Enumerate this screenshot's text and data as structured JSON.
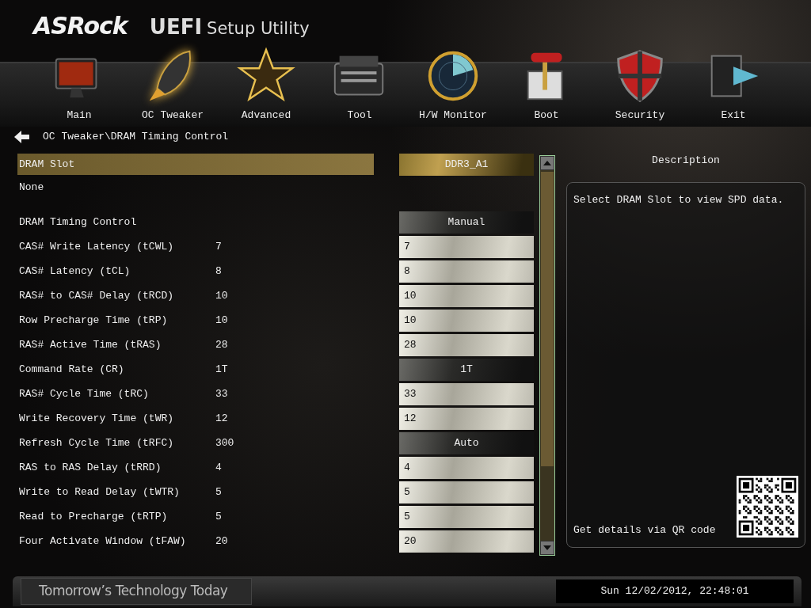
{
  "header": {
    "brand": "ASRock",
    "product": "UEFI",
    "subtitle": "Setup Utility"
  },
  "tabs": [
    {
      "label": "Main",
      "kind": "monitor",
      "selected": false
    },
    {
      "label": "OC Tweaker",
      "kind": "rocket",
      "selected": true
    },
    {
      "label": "Advanced",
      "kind": "star",
      "selected": false
    },
    {
      "label": "Tool",
      "kind": "toolbox",
      "selected": false
    },
    {
      "label": "H/W Monitor",
      "kind": "radar",
      "selected": false
    },
    {
      "label": "Boot",
      "kind": "lever",
      "selected": false
    },
    {
      "label": "Security",
      "kind": "shield",
      "selected": false
    },
    {
      "label": "Exit",
      "kind": "exit",
      "selected": false
    }
  ],
  "breadcrumb": "OC Tweaker\\DRAM Timing Control",
  "settings": [
    {
      "label": "DRAM Slot",
      "kind": "select",
      "control": "DDR3_A1",
      "selected": true
    },
    {
      "label": "None",
      "kind": "info",
      "selected": false
    },
    {
      "label": "DRAM Timing Control",
      "kind": "select",
      "control": "Manual",
      "selected": false
    },
    {
      "label": "CAS# Write Latency (tCWL)",
      "value": "7",
      "kind": "input",
      "control": "7",
      "selected": false
    },
    {
      "label": "CAS# Latency (tCL)",
      "value": "8",
      "kind": "input",
      "control": "8",
      "selected": false
    },
    {
      "label": "RAS# to CAS# Delay (tRCD)",
      "value": "10",
      "kind": "input",
      "control": "10",
      "selected": false
    },
    {
      "label": "Row Precharge Time (tRP)",
      "value": "10",
      "kind": "input",
      "control": "10",
      "selected": false
    },
    {
      "label": "RAS# Active Time (tRAS)",
      "value": "28",
      "kind": "input",
      "control": "28",
      "selected": false
    },
    {
      "label": "Command Rate (CR)",
      "value": "1T",
      "kind": "select",
      "control": "1T",
      "selected": false
    },
    {
      "label": "RAS# Cycle Time (tRC)",
      "value": "33",
      "kind": "input",
      "control": "33",
      "selected": false
    },
    {
      "label": "Write Recovery Time (tWR)",
      "value": "12",
      "kind": "input",
      "control": "12",
      "selected": false
    },
    {
      "label": "Refresh Cycle Time (tRFC)",
      "value": "300",
      "kind": "select",
      "control": "Auto",
      "selected": false
    },
    {
      "label": "RAS to RAS Delay (tRRD)",
      "value": "4",
      "kind": "input",
      "control": "4",
      "selected": false
    },
    {
      "label": "Write to Read Delay (tWTR)",
      "value": "5",
      "kind": "input",
      "control": "5",
      "selected": false
    },
    {
      "label": "Read to Precharge (tRTP)",
      "value": "5",
      "kind": "input",
      "control": "5",
      "selected": false
    },
    {
      "label": "Four Activate Window (tFAW)",
      "value": "20",
      "kind": "input",
      "control": "20",
      "selected": false
    }
  ],
  "description": {
    "title": "Description",
    "text": "Select DRAM Slot to view SPD data.",
    "qr_caption": "Get details via QR code"
  },
  "footer": {
    "slogan": "Tomorrow’s Technology Today",
    "clock": "Sun 12/02/2012, 22:48:01"
  }
}
